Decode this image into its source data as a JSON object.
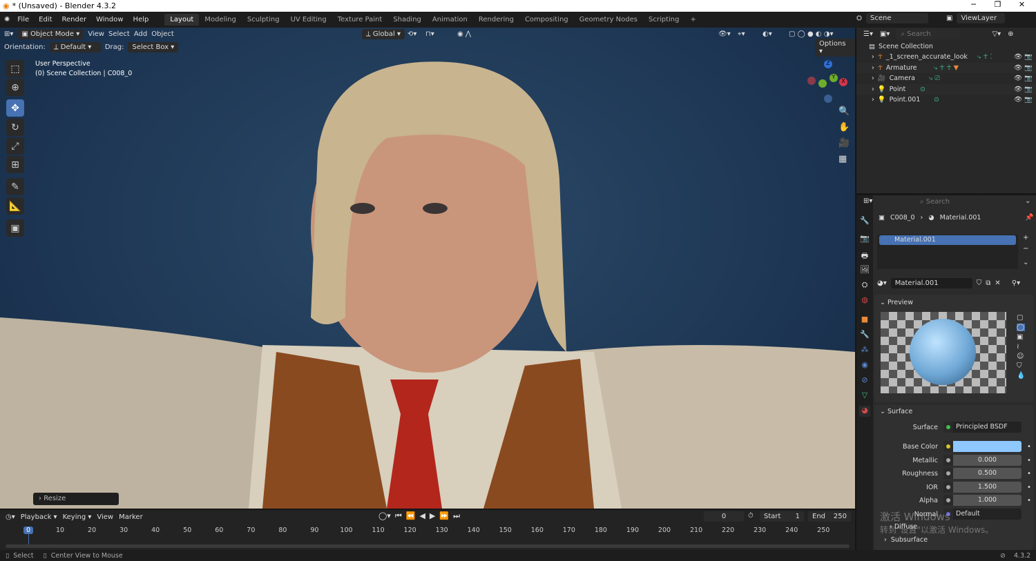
{
  "window": {
    "title": "* (Unsaved) - Blender 4.3.2",
    "minimize": "─",
    "maximize": "❐",
    "close": "✕"
  },
  "menu": [
    "File",
    "Edit",
    "Render",
    "Window",
    "Help"
  ],
  "workspaces": [
    "Layout",
    "Modeling",
    "Sculpting",
    "UV Editing",
    "Texture Paint",
    "Shading",
    "Animation",
    "Rendering",
    "Compositing",
    "Geometry Nodes",
    "Scripting",
    "+"
  ],
  "viewport": {
    "mode": "Object Mode",
    "menus": [
      "View",
      "Select",
      "Add",
      "Object"
    ],
    "transform": "Global",
    "orientation_label": "Orientation:",
    "orientation": "Default",
    "drag_label": "Drag:",
    "drag": "Select Box",
    "options": "Options",
    "overlay_title": "User Perspective",
    "overlay_sub": "(0) Scene Collection | C008_0",
    "last_op": "Resize",
    "gizmo": {
      "x": "X",
      "y": "Y",
      "z": "Z"
    }
  },
  "topright": {
    "scene": "Scene",
    "viewlayer": "ViewLayer"
  },
  "outliner": {
    "search_placeholder": "Search",
    "root": "Scene Collection",
    "items": [
      "_1_screen_accurate_look",
      "Armature",
      "Camera",
      "Point",
      "Point.001"
    ]
  },
  "properties": {
    "search_placeholder": "Search",
    "breadcrumb_object": "C008_0",
    "breadcrumb_material": "Material.001",
    "slot": "Material.001",
    "material_name": "Material.001",
    "preview_label": "Preview",
    "surface_panel": "Surface",
    "rows": [
      {
        "label": "Surface",
        "value": "Principled BSDF",
        "socket": "#3fbf4f"
      },
      {
        "label": "Base Color",
        "value": "",
        "socket": "#d4c62a",
        "color": "#8ec8ff"
      },
      {
        "label": "Metallic",
        "value": "0.000",
        "fraction": 0
      },
      {
        "label": "Roughness",
        "value": "0.500",
        "fraction": 0.5
      },
      {
        "label": "IOR",
        "value": "1.500",
        "fraction": 0
      },
      {
        "label": "Alpha",
        "value": "1.000",
        "fraction": 1
      },
      {
        "label": "Normal",
        "value": "Default",
        "socket": "#6b6bd6"
      }
    ],
    "diffuse": "Diffuse",
    "subsurface": "Subsurface"
  },
  "timeline": {
    "menus": [
      "Playback",
      "Keying",
      "View",
      "Marker"
    ],
    "current_frame": "0",
    "start_label": "Start",
    "start": "1",
    "end_label": "End",
    "end": "250",
    "ticks": [
      0,
      10,
      20,
      30,
      40,
      50,
      60,
      70,
      80,
      90,
      100,
      110,
      120,
      130,
      140,
      150,
      160,
      170,
      180,
      190,
      200,
      210,
      220,
      230,
      240,
      250
    ]
  },
  "watermark": {
    "line1": "激活 Windows",
    "line2": "转到\"设置\"以激活 Windows。"
  },
  "status": {
    "select": "Select",
    "center": "Center View to Mouse",
    "version": "4.3.2"
  }
}
